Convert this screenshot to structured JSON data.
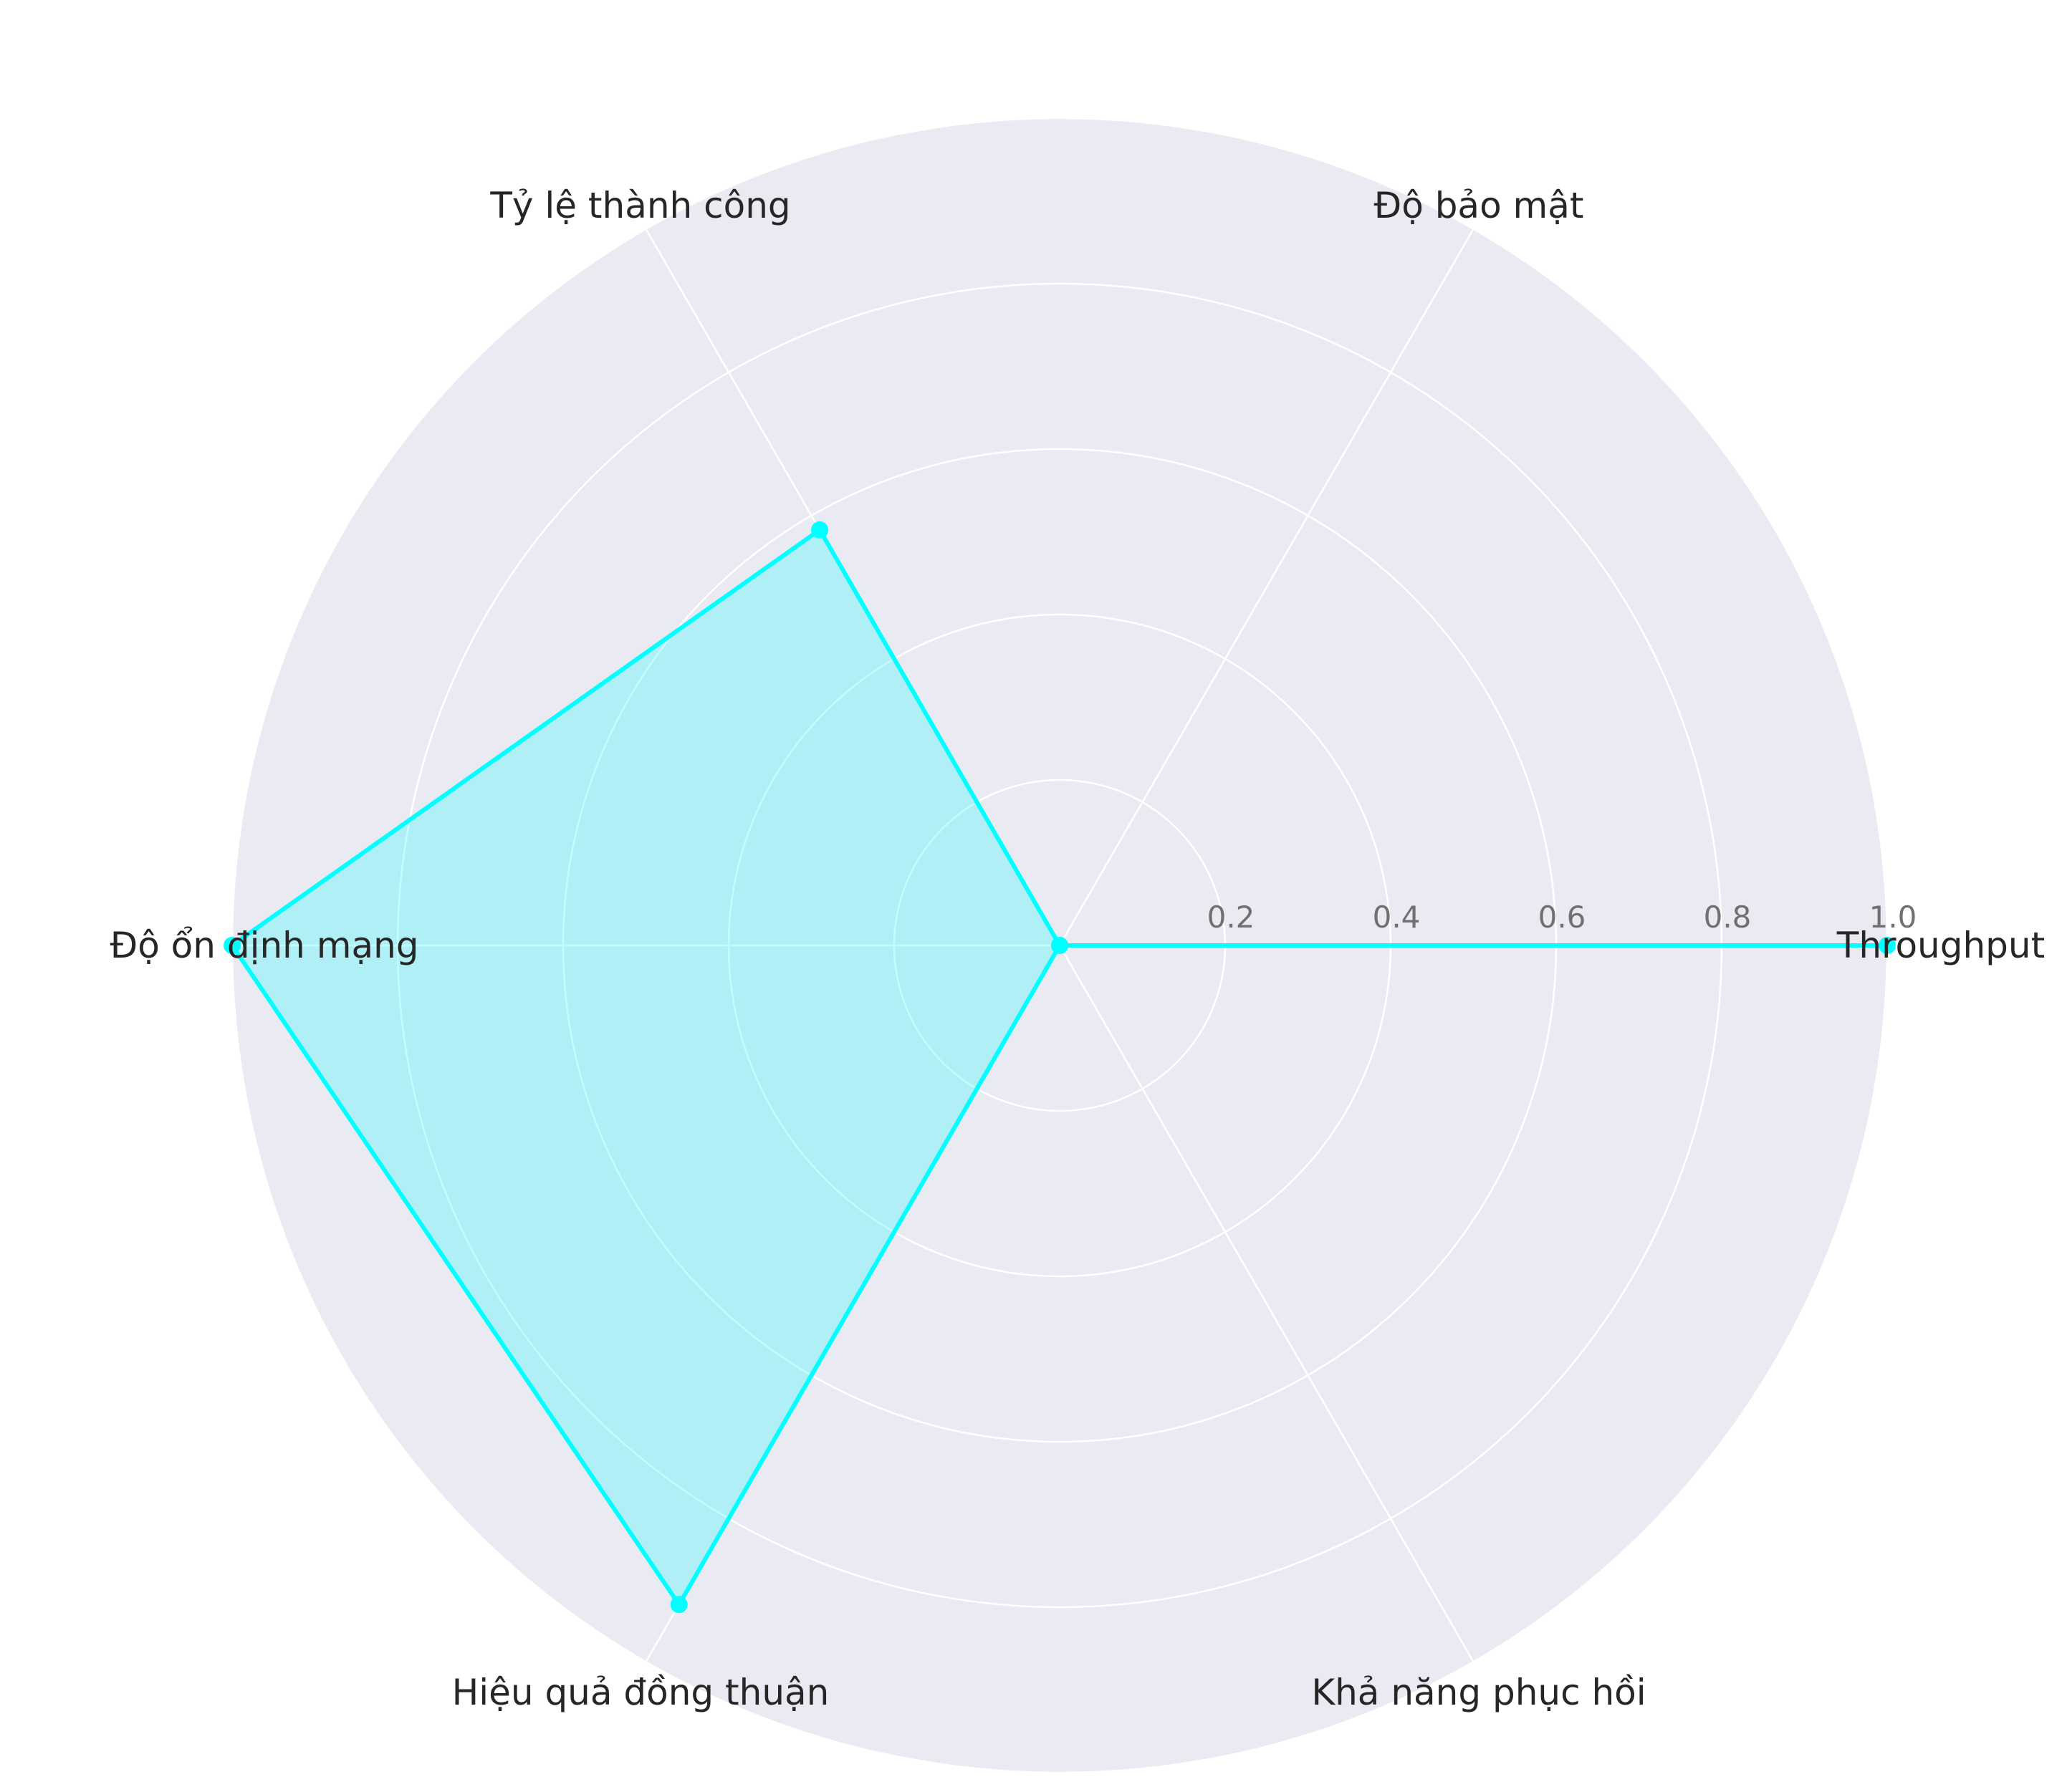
{
  "chart_data": {
    "type": "radar",
    "categories": [
      "Throughput",
      "Độ bảo mật",
      "Tỷ lệ thành công",
      "Độ ổn định mạng",
      "Hiệu quả đồng thuận",
      "Khả năng phục hồi"
    ],
    "series": [
      {
        "values": [
          1.0,
          0.0,
          0.58,
          1.0,
          0.92,
          0.0
        ]
      }
    ],
    "rlim": [
      0,
      1.0
    ],
    "r_ticks": [
      0.2,
      0.4,
      0.6,
      0.8,
      1.0
    ],
    "r_tick_labels": [
      "0.2",
      "0.4",
      "0.6",
      "0.8",
      "1.0"
    ],
    "grid": true,
    "colors": {
      "line": "#00FFFF",
      "fill": "#00FFFF",
      "background": "#EAEAF2",
      "grid": "#FFFFFF"
    }
  }
}
